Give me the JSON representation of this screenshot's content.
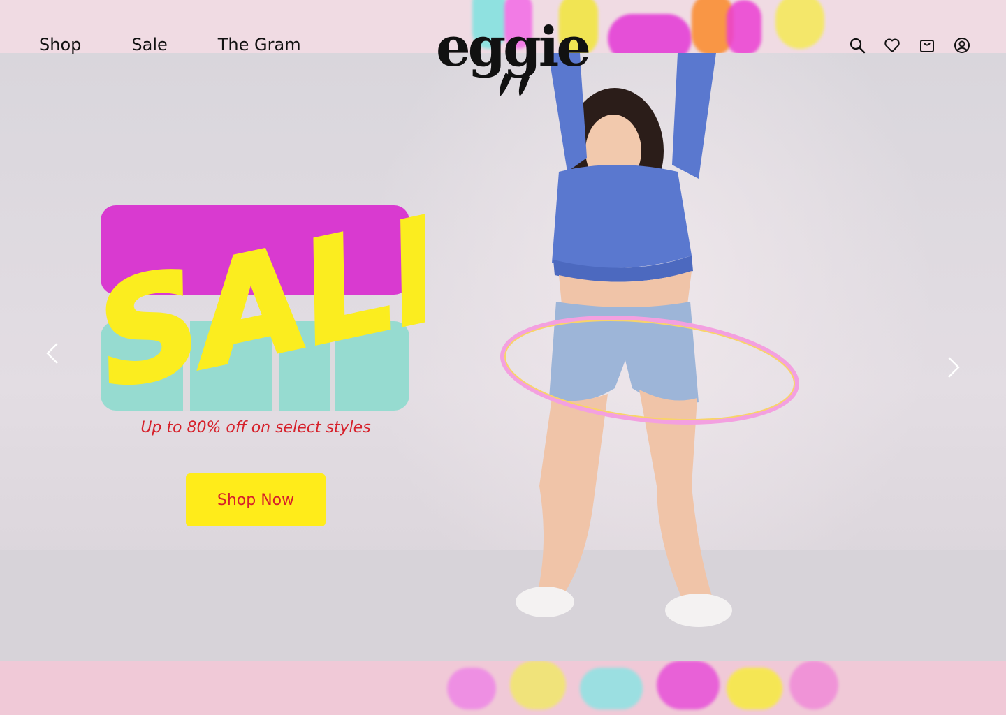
{
  "nav": {
    "items": [
      {
        "label": "Shop"
      },
      {
        "label": "Sale"
      },
      {
        "label": "The Gram"
      }
    ]
  },
  "logo": {
    "text": "eggie"
  },
  "header_icons": [
    "search-icon",
    "heart-icon",
    "cart-icon",
    "account-icon"
  ],
  "hero": {
    "headline": "SALE",
    "subtitle": "Up to 80% off on select styles",
    "cta_label": "Shop Now"
  },
  "colors": {
    "magenta": "#d93ad0",
    "teal": "#96dbd0",
    "yellow": "#ffec1a",
    "red": "#d6202a",
    "sweater_blue": "#5a78cf"
  }
}
